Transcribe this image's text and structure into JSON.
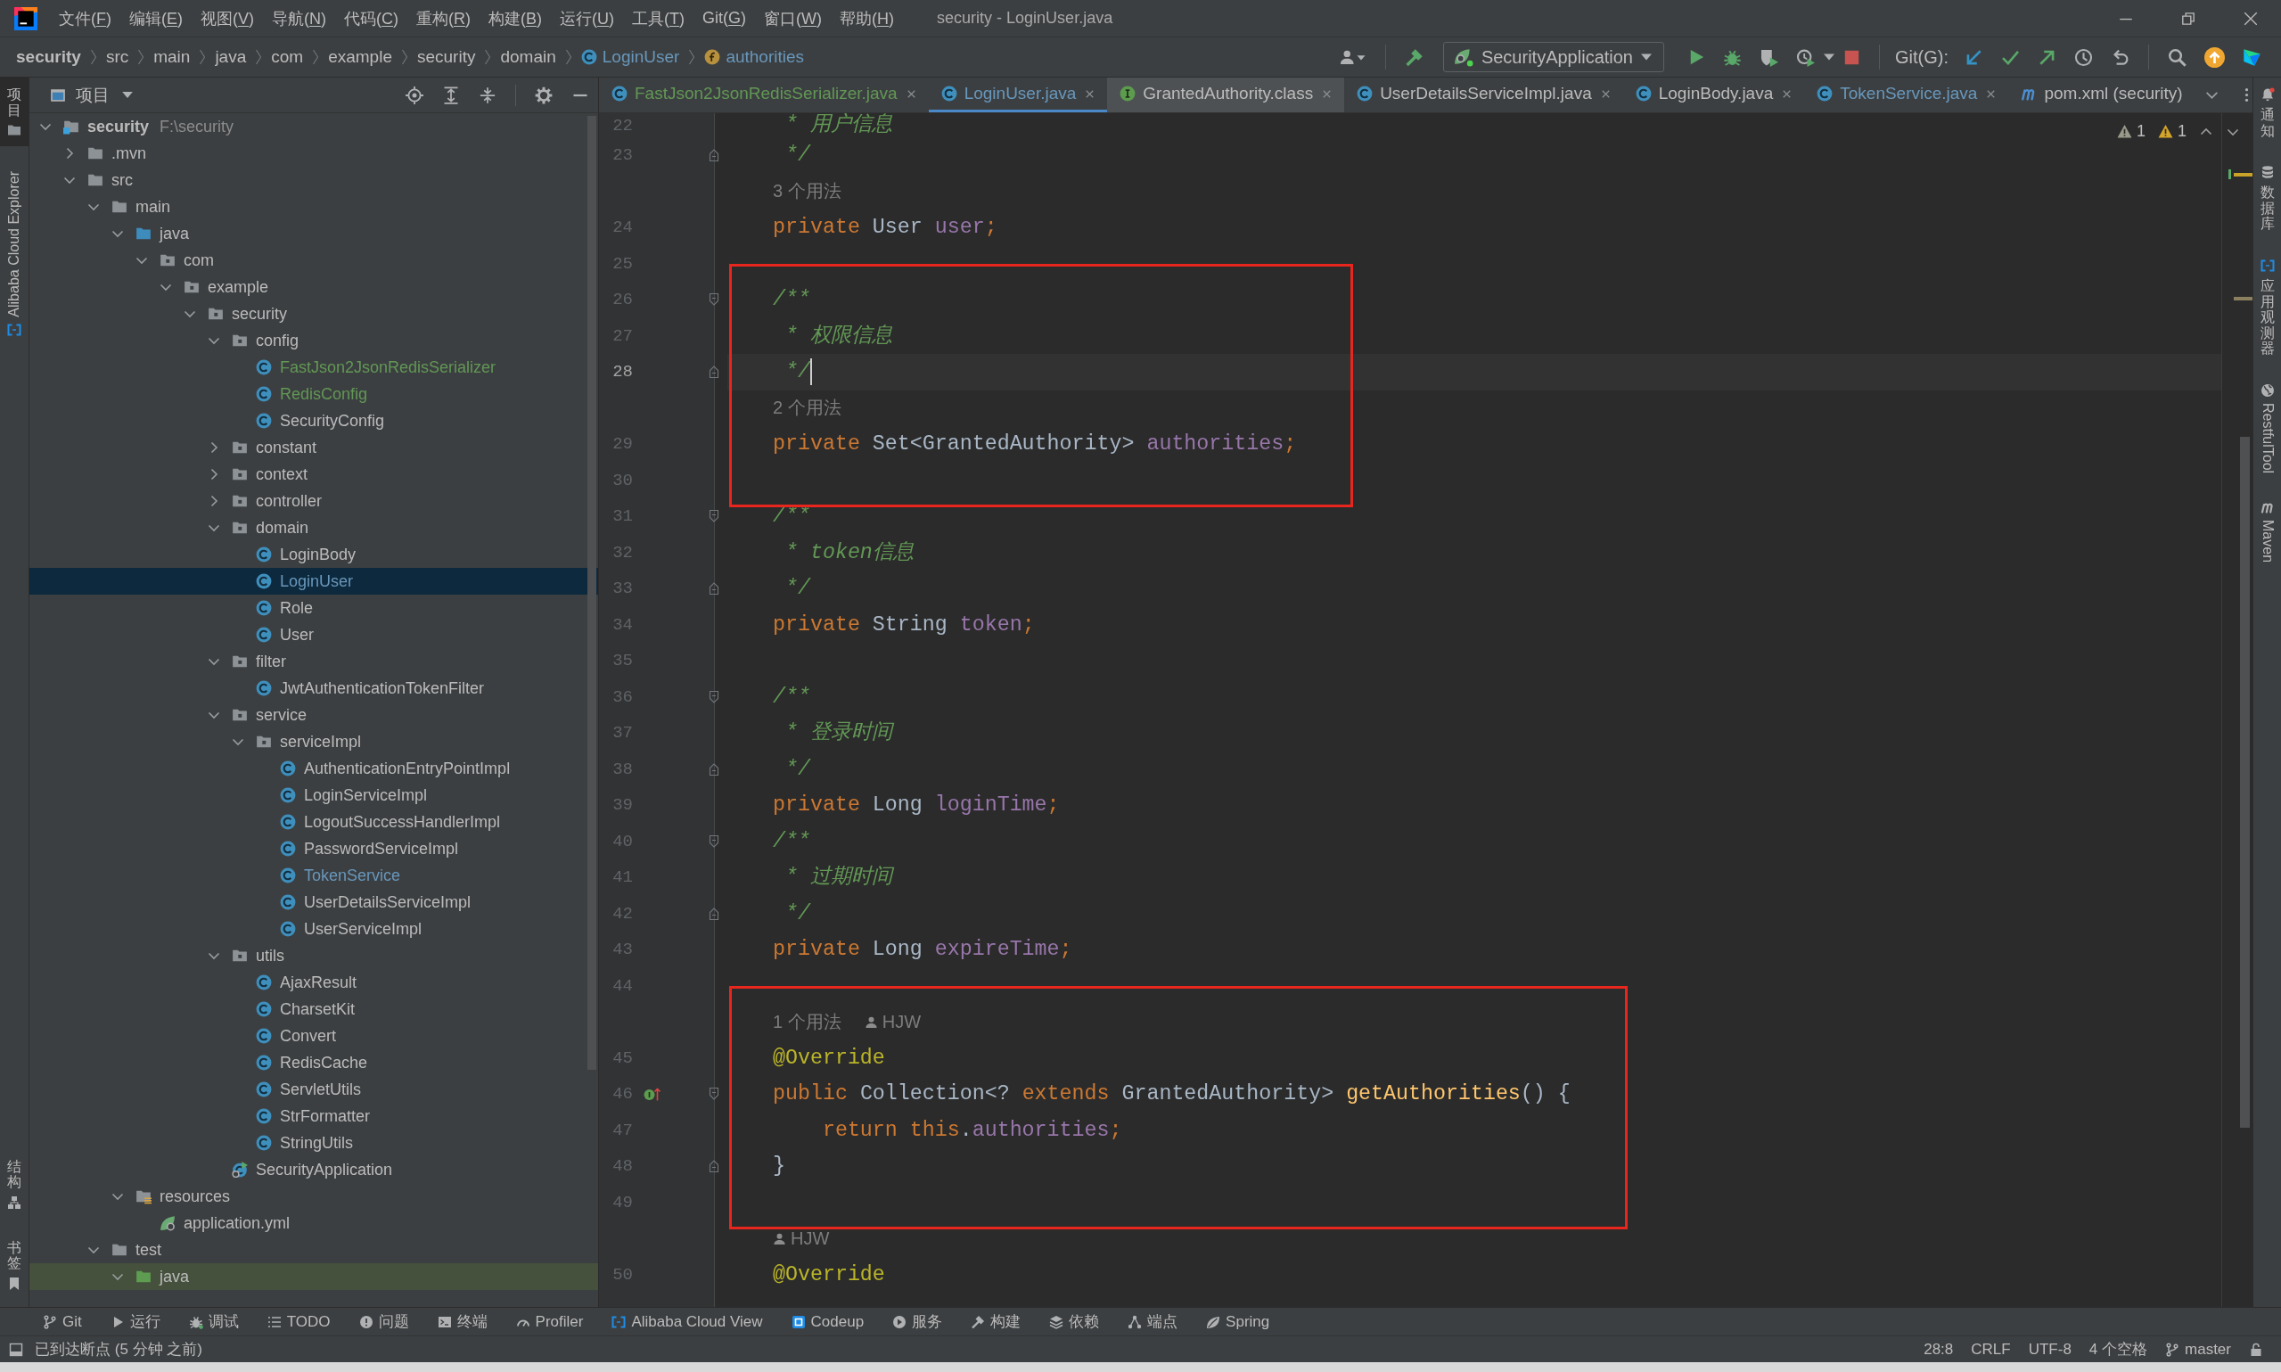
{
  "window": {
    "title": "security - LoginUser.java"
  },
  "menu": [
    {
      "before": "文件(",
      "mnemonic": "F",
      "after": ")"
    },
    {
      "before": "编辑(",
      "mnemonic": "E",
      "after": ")"
    },
    {
      "before": "视图(",
      "mnemonic": "V",
      "after": ")"
    },
    {
      "before": "导航(",
      "mnemonic": "N",
      "after": ")"
    },
    {
      "before": "代码(",
      "mnemonic": "C",
      "after": ")"
    },
    {
      "before": "重构(",
      "mnemonic": "R",
      "after": ")"
    },
    {
      "before": "构建(",
      "mnemonic": "B",
      "after": ")"
    },
    {
      "before": "运行(",
      "mnemonic": "U",
      "after": ")"
    },
    {
      "before": "工具(",
      "mnemonic": "T",
      "after": ")"
    },
    {
      "before": "Git(",
      "mnemonic": "G",
      "after": ")"
    },
    {
      "before": "窗口(",
      "mnemonic": "W",
      "after": ")"
    },
    {
      "before": "帮助(",
      "mnemonic": "H",
      "after": ")"
    }
  ],
  "breadcrumbs": [
    {
      "label": "security",
      "kind": "project"
    },
    {
      "label": "src",
      "kind": "folder"
    },
    {
      "label": "main",
      "kind": "folder"
    },
    {
      "label": "java",
      "kind": "folder"
    },
    {
      "label": "com",
      "kind": "folder"
    },
    {
      "label": "example",
      "kind": "folder"
    },
    {
      "label": "security",
      "kind": "folder"
    },
    {
      "label": "domain",
      "kind": "folder"
    },
    {
      "label": "LoginUser",
      "kind": "class"
    },
    {
      "label": "authorities",
      "kind": "field"
    }
  ],
  "toolbar": {
    "run_configuration": "SecurityApplication",
    "vcs_label": "Git(G):"
  },
  "left_strip": {
    "top": [
      {
        "label": "项目",
        "kind": "project",
        "selected": true
      },
      {
        "label": "Alibaba Cloud Explorer",
        "kind": "cloud",
        "selected": false
      }
    ],
    "bottom": [
      {
        "label": "结构",
        "kind": "structure",
        "selected": false
      },
      {
        "label": "书签",
        "kind": "bookmarks",
        "selected": false
      }
    ]
  },
  "project_panel": {
    "title": "项目",
    "tree": [
      {
        "label": "security",
        "path": "F:\\security",
        "kind": "module",
        "color": "#bbbbbb",
        "selected": false,
        "expanded": true,
        "children": [
          {
            "label": ".mvn",
            "kind": "folder",
            "color": "#bbbbbb",
            "selected": false,
            "expanded": false
          },
          {
            "label": "src",
            "kind": "folder",
            "color": "#bbbbbb",
            "selected": false,
            "expanded": true,
            "children": [
              {
                "label": "main",
                "kind": "folder",
                "color": "#bbbbbb",
                "selected": false,
                "expanded": true,
                "children": [
                  {
                    "label": "java",
                    "kind": "source_root",
                    "color": "#bbbbbb",
                    "selected": false,
                    "expanded": true,
                    "children": [
                      {
                        "label": "com",
                        "kind": "package",
                        "color": "#bbbbbb",
                        "selected": false,
                        "expanded": true,
                        "children": [
                          {
                            "label": "example",
                            "kind": "package",
                            "color": "#bbbbbb",
                            "selected": false,
                            "expanded": true,
                            "children": [
                              {
                                "label": "security",
                                "kind": "package",
                                "color": "#bbbbbb",
                                "selected": false,
                                "expanded": true,
                                "children": [
                                  {
                                    "label": "config",
                                    "kind": "package",
                                    "color": "#bbbbbb",
                                    "selected": false,
                                    "expanded": true,
                                    "children": [
                                      {
                                        "label": "FastJson2JsonRedisSerializer",
                                        "kind": "class",
                                        "color": "#629755",
                                        "selected": false
                                      },
                                      {
                                        "label": "RedisConfig",
                                        "kind": "class",
                                        "color": "#629755",
                                        "selected": false
                                      },
                                      {
                                        "label": "SecurityConfig",
                                        "kind": "class",
                                        "color": "#bbbbbb",
                                        "selected": false
                                      }
                                    ]
                                  },
                                  {
                                    "label": "constant",
                                    "kind": "package",
                                    "color": "#bbbbbb",
                                    "selected": false,
                                    "expanded": false
                                  },
                                  {
                                    "label": "context",
                                    "kind": "package",
                                    "color": "#bbbbbb",
                                    "selected": false,
                                    "expanded": false
                                  },
                                  {
                                    "label": "controller",
                                    "kind": "package",
                                    "color": "#bbbbbb",
                                    "selected": false,
                                    "expanded": false
                                  },
                                  {
                                    "label": "domain",
                                    "kind": "package",
                                    "color": "#bbbbbb",
                                    "selected": false,
                                    "expanded": true,
                                    "children": [
                                      {
                                        "label": "LoginBody",
                                        "kind": "class",
                                        "color": "#bbbbbb",
                                        "selected": false
                                      },
                                      {
                                        "label": "LoginUser",
                                        "kind": "class",
                                        "color": "#6897bb",
                                        "selected": true
                                      },
                                      {
                                        "label": "Role",
                                        "kind": "class",
                                        "color": "#bbbbbb",
                                        "selected": false
                                      },
                                      {
                                        "label": "User",
                                        "kind": "class",
                                        "color": "#bbbbbb",
                                        "selected": false
                                      }
                                    ]
                                  },
                                  {
                                    "label": "filter",
                                    "kind": "package",
                                    "color": "#bbbbbb",
                                    "selected": false,
                                    "expanded": true,
                                    "children": [
                                      {
                                        "label": "JwtAuthenticationTokenFilter",
                                        "kind": "class",
                                        "color": "#bbbbbb",
                                        "selected": false
                                      }
                                    ]
                                  },
                                  {
                                    "label": "service",
                                    "kind": "package",
                                    "color": "#bbbbbb",
                                    "selected": false,
                                    "expanded": true,
                                    "children": [
                                      {
                                        "label": "serviceImpl",
                                        "kind": "package",
                                        "color": "#bbbbbb",
                                        "selected": false,
                                        "expanded": true,
                                        "children": [
                                          {
                                            "label": "AuthenticationEntryPointImpl",
                                            "kind": "class",
                                            "color": "#bbbbbb",
                                            "selected": false
                                          },
                                          {
                                            "label": "LoginServiceImpl",
                                            "kind": "class",
                                            "color": "#bbbbbb",
                                            "selected": false
                                          },
                                          {
                                            "label": "LogoutSuccessHandlerImpl",
                                            "kind": "class",
                                            "color": "#bbbbbb",
                                            "selected": false
                                          },
                                          {
                                            "label": "PasswordServiceImpl",
                                            "kind": "class",
                                            "color": "#bbbbbb",
                                            "selected": false
                                          },
                                          {
                                            "label": "TokenService",
                                            "kind": "class",
                                            "color": "#6897bb",
                                            "selected": false
                                          },
                                          {
                                            "label": "UserDetailsServiceImpl",
                                            "kind": "class",
                                            "color": "#bbbbbb",
                                            "selected": false
                                          },
                                          {
                                            "label": "UserServiceImpl",
                                            "kind": "class",
                                            "color": "#bbbbbb",
                                            "selected": false
                                          }
                                        ]
                                      }
                                    ]
                                  },
                                  {
                                    "label": "utils",
                                    "kind": "package",
                                    "color": "#bbbbbb",
                                    "selected": false,
                                    "expanded": true,
                                    "children": [
                                      {
                                        "label": "AjaxResult",
                                        "kind": "class",
                                        "color": "#bbbbbb",
                                        "selected": false
                                      },
                                      {
                                        "label": "CharsetKit",
                                        "kind": "class",
                                        "color": "#bbbbbb",
                                        "selected": false
                                      },
                                      {
                                        "label": "Convert",
                                        "kind": "class",
                                        "color": "#bbbbbb",
                                        "selected": false
                                      },
                                      {
                                        "label": "RedisCache",
                                        "kind": "class",
                                        "color": "#bbbbbb",
                                        "selected": false
                                      },
                                      {
                                        "label": "ServletUtils",
                                        "kind": "class",
                                        "color": "#bbbbbb",
                                        "selected": false
                                      },
                                      {
                                        "label": "StrFormatter",
                                        "kind": "class",
                                        "color": "#bbbbbb",
                                        "selected": false
                                      },
                                      {
                                        "label": "StringUtils",
                                        "kind": "class",
                                        "color": "#bbbbbb",
                                        "selected": false
                                      }
                                    ]
                                  },
                                  {
                                    "label": "SecurityApplication",
                                    "kind": "spring_app",
                                    "color": "#bbbbbb",
                                    "selected": false
                                  }
                                ]
                              }
                            ]
                          }
                        ]
                      }
                    ]
                  },
                  {
                    "label": "resources",
                    "kind": "resources_root",
                    "color": "#bbbbbb",
                    "selected": false,
                    "expanded": true,
                    "children": [
                      {
                        "label": "application.yml",
                        "kind": "yml",
                        "color": "#bbbbbb",
                        "selected": false
                      }
                    ]
                  }
                ]
              },
              {
                "label": "test",
                "kind": "folder",
                "color": "#bbbbbb",
                "selected": false,
                "expanded": true,
                "children": [
                  {
                    "label": "java",
                    "kind": "test_root",
                    "color": "#bbbbbb",
                    "selected": false,
                    "expanded": true
                  }
                ]
              }
            ]
          }
        ]
      }
    ]
  },
  "editor": {
    "tabs": [
      {
        "label": "FastJson2JsonRedisSerializer.java",
        "kind": "class",
        "color": "#629755",
        "selected": false,
        "non_project": false,
        "closable": true
      },
      {
        "label": "LoginUser.java",
        "kind": "class",
        "color": "#6897bb",
        "selected": true,
        "non_project": false,
        "closable": true
      },
      {
        "label": "GrantedAuthority.class",
        "kind": "interface",
        "color": "#bbbbbb",
        "selected": false,
        "non_project": true,
        "closable": true
      },
      {
        "label": "UserDetailsServiceImpl.java",
        "kind": "class",
        "color": "#bbbbbb",
        "selected": false,
        "non_project": false,
        "closable": true
      },
      {
        "label": "LoginBody.java",
        "kind": "class",
        "color": "#bbbbbb",
        "selected": false,
        "non_project": false,
        "closable": true
      },
      {
        "label": "TokenService.java",
        "kind": "class",
        "color": "#6897bb",
        "selected": false,
        "non_project": false,
        "closable": true
      },
      {
        "label": "pom.xml (security)",
        "kind": "maven",
        "color": "#bbbbbb",
        "selected": false,
        "non_project": false,
        "closable": false
      }
    ],
    "inspections": [
      {
        "kind": "weak_warning",
        "count": "1"
      },
      {
        "kind": "warning",
        "count": "1"
      }
    ],
    "lines": [
      {
        "kind": "code",
        "number": "22",
        "tokens": [
          {
            "kind": "doc",
            "text": " * 用户信息"
          }
        ],
        "current": false,
        "highlighted": false
      },
      {
        "kind": "code",
        "number": "23",
        "tokens": [
          {
            "kind": "doc",
            "text": " */"
          }
        ],
        "fold_end": true,
        "current": false,
        "highlighted": false
      },
      {
        "kind": "hint",
        "usages": "3 个用法",
        "highlighted": false
      },
      {
        "kind": "code",
        "number": "24",
        "tokens": [
          {
            "kind": "keyword",
            "text": "private "
          },
          {
            "kind": "type",
            "text": "User "
          },
          {
            "kind": "field",
            "text": "user"
          },
          {
            "kind": "punct",
            "text": ";"
          }
        ],
        "current": false,
        "highlighted": false
      },
      {
        "kind": "code",
        "number": "25",
        "current": false,
        "highlighted": false
      },
      {
        "kind": "code",
        "number": "26",
        "tokens": [
          {
            "kind": "doc",
            "text": "/**"
          }
        ],
        "fold_start": true,
        "current": false,
        "highlighted": true
      },
      {
        "kind": "code",
        "number": "27",
        "tokens": [
          {
            "kind": "doc",
            "text": " * 权限信息"
          }
        ],
        "current": false,
        "highlighted": true
      },
      {
        "kind": "code",
        "number": "28",
        "tokens": [
          {
            "kind": "doc",
            "text": " */"
          }
        ],
        "fold_end": true,
        "current": true,
        "highlighted": true
      },
      {
        "kind": "hint",
        "usages": "2 个用法",
        "highlighted": true
      },
      {
        "kind": "code",
        "number": "29",
        "tokens": [
          {
            "kind": "keyword",
            "text": "private "
          },
          {
            "kind": "type",
            "text": "Set<GrantedAuthority> "
          },
          {
            "kind": "field",
            "text": "authorities"
          },
          {
            "kind": "punct",
            "text": ";"
          }
        ],
        "current": false,
        "highlighted": true
      },
      {
        "kind": "code",
        "number": "30",
        "current": false,
        "highlighted": true
      },
      {
        "kind": "code",
        "number": "31",
        "tokens": [
          {
            "kind": "doc",
            "text": "/**"
          }
        ],
        "fold_start": true,
        "current": false,
        "highlighted": false
      },
      {
        "kind": "code",
        "number": "32",
        "tokens": [
          {
            "kind": "doc",
            "text": " * token信息"
          }
        ],
        "current": false,
        "highlighted": false
      },
      {
        "kind": "code",
        "number": "33",
        "tokens": [
          {
            "kind": "doc",
            "text": " */"
          }
        ],
        "fold_end": true,
        "current": false,
        "highlighted": false
      },
      {
        "kind": "code",
        "number": "34",
        "tokens": [
          {
            "kind": "keyword",
            "text": "private "
          },
          {
            "kind": "type",
            "text": "String "
          },
          {
            "kind": "field",
            "text": "token"
          },
          {
            "kind": "punct",
            "text": ";"
          }
        ],
        "current": false,
        "highlighted": false
      },
      {
        "kind": "code",
        "number": "35",
        "current": false,
        "highlighted": false
      },
      {
        "kind": "code",
        "number": "36",
        "tokens": [
          {
            "kind": "doc",
            "text": "/**"
          }
        ],
        "fold_start": true,
        "current": false,
        "highlighted": false
      },
      {
        "kind": "code",
        "number": "37",
        "tokens": [
          {
            "kind": "doc",
            "text": " * 登录时间"
          }
        ],
        "current": false,
        "highlighted": false
      },
      {
        "kind": "code",
        "number": "38",
        "tokens": [
          {
            "kind": "doc",
            "text": " */"
          }
        ],
        "fold_end": true,
        "current": false,
        "highlighted": false
      },
      {
        "kind": "code",
        "number": "39",
        "tokens": [
          {
            "kind": "keyword",
            "text": "private "
          },
          {
            "kind": "type",
            "text": "Long "
          },
          {
            "kind": "field",
            "text": "loginTime"
          },
          {
            "kind": "punct",
            "text": ";"
          }
        ],
        "current": false,
        "highlighted": false
      },
      {
        "kind": "code",
        "number": "40",
        "tokens": [
          {
            "kind": "doc",
            "text": "/**"
          }
        ],
        "fold_start": true,
        "current": false,
        "highlighted": false
      },
      {
        "kind": "code",
        "number": "41",
        "tokens": [
          {
            "kind": "doc",
            "text": " * 过期时间"
          }
        ],
        "current": false,
        "highlighted": false
      },
      {
        "kind": "code",
        "number": "42",
        "tokens": [
          {
            "kind": "doc",
            "text": " */"
          }
        ],
        "fold_end": true,
        "current": false,
        "highlighted": false
      },
      {
        "kind": "code",
        "number": "43",
        "tokens": [
          {
            "kind": "keyword",
            "text": "private "
          },
          {
            "kind": "type",
            "text": "Long "
          },
          {
            "kind": "field",
            "text": "expireTime"
          },
          {
            "kind": "punct",
            "text": ";"
          }
        ],
        "current": false,
        "highlighted": false
      },
      {
        "kind": "code",
        "number": "44",
        "current": false,
        "highlighted": false
      },
      {
        "kind": "hint",
        "usages": "1 个用法",
        "author": "HJW",
        "highlighted": true
      },
      {
        "kind": "code",
        "number": "45",
        "tokens": [
          {
            "kind": "annotation",
            "text": "@Override"
          }
        ],
        "current": false,
        "highlighted": true
      },
      {
        "kind": "code",
        "number": "46",
        "tokens": [
          {
            "kind": "keyword",
            "text": "public "
          },
          {
            "kind": "type",
            "text": "Collection<? "
          },
          {
            "kind": "keyword",
            "text": "extends "
          },
          {
            "kind": "type",
            "text": "GrantedAuthority> "
          },
          {
            "kind": "method",
            "text": "getAuthorities"
          },
          {
            "kind": "plain",
            "text": "() {"
          }
        ],
        "implements": true,
        "fold_start": true,
        "current": false,
        "highlighted": true
      },
      {
        "kind": "code",
        "number": "47",
        "tokens": [
          {
            "kind": "keyword",
            "text": "    return "
          },
          {
            "kind": "keyword",
            "text": "this"
          },
          {
            "kind": "plain",
            "text": "."
          },
          {
            "kind": "field",
            "text": "authorities"
          },
          {
            "kind": "punct",
            "text": ";"
          }
        ],
        "current": false,
        "highlighted": true
      },
      {
        "kind": "code",
        "number": "48",
        "tokens": [
          {
            "kind": "plain",
            "text": "}"
          }
        ],
        "fold_end": true,
        "current": false,
        "highlighted": true
      },
      {
        "kind": "code",
        "number": "49",
        "current": false,
        "highlighted": true
      },
      {
        "kind": "hint",
        "author": "HJW",
        "highlighted": false
      },
      {
        "kind": "code",
        "number": "50",
        "tokens": [
          {
            "kind": "annotation",
            "text": "@Override"
          }
        ],
        "current": false,
        "highlighted": false
      }
    ]
  },
  "right_strip": [
    {
      "label": "通知",
      "kind": "notifications",
      "selected": false
    },
    {
      "label": "数据库",
      "kind": "database",
      "selected": false
    },
    {
      "label": "应用观测器",
      "kind": "observer",
      "selected": false
    },
    {
      "label": "RestfulTool",
      "kind": "restful",
      "selected": false
    },
    {
      "label": "Maven",
      "kind": "maven",
      "selected": false
    }
  ],
  "tool_windows": [
    {
      "label": "Git",
      "kind": "git",
      "selected": false
    },
    {
      "label": "运行",
      "kind": "run",
      "selected": false
    },
    {
      "label": "调试",
      "kind": "debug",
      "selected": false
    },
    {
      "label": "TODO",
      "kind": "todo",
      "selected": false
    },
    {
      "label": "问题",
      "kind": "problems",
      "selected": false
    },
    {
      "label": "终端",
      "kind": "terminal",
      "selected": false
    },
    {
      "label": "Profiler",
      "kind": "profiler",
      "selected": false
    },
    {
      "label": "Alibaba Cloud View",
      "kind": "cloud",
      "selected": false
    },
    {
      "label": "Codeup",
      "kind": "codeup",
      "selected": false
    },
    {
      "label": "服务",
      "kind": "services",
      "selected": false
    },
    {
      "label": "构建",
      "kind": "build",
      "selected": false
    },
    {
      "label": "依赖",
      "kind": "dependencies",
      "selected": false
    },
    {
      "label": "端点",
      "kind": "endpoints",
      "selected": false
    },
    {
      "label": "Spring",
      "kind": "spring",
      "selected": false
    }
  ],
  "status_bar": {
    "message": "已到达断点 (5 分钟 之前)",
    "position": "28:8",
    "line_separator": "CRLF",
    "encoding": "UTF-8",
    "indent": "4 个空格",
    "branch": "master"
  }
}
